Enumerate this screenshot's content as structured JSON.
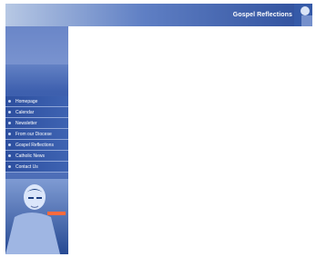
{
  "header": {
    "site_title": "Gospel Reflections"
  },
  "nav": {
    "items": [
      {
        "label": "Homepage",
        "name": "nav-homepage"
      },
      {
        "label": "Calendar",
        "name": "nav-calendar"
      },
      {
        "label": "Newsletter",
        "name": "nav-newsletter"
      },
      {
        "label": "From our Diocese",
        "name": "nav-from-our-diocese"
      },
      {
        "label": "Gospel Reflections",
        "name": "nav-gospel-reflections"
      },
      {
        "label": "Catholic News",
        "name": "nav-catholic-news"
      },
      {
        "label": "Contact Us",
        "name": "nav-contact-us"
      }
    ]
  },
  "colors": {
    "header_gradient": [
      "#b7c8e4",
      "#2e4f9c"
    ],
    "sidebar": "#3d5fae",
    "nav_item": "#2d4f9f",
    "nav_text": "#ffffff"
  },
  "icons": {
    "nav_bullet": "bullet-icon"
  }
}
